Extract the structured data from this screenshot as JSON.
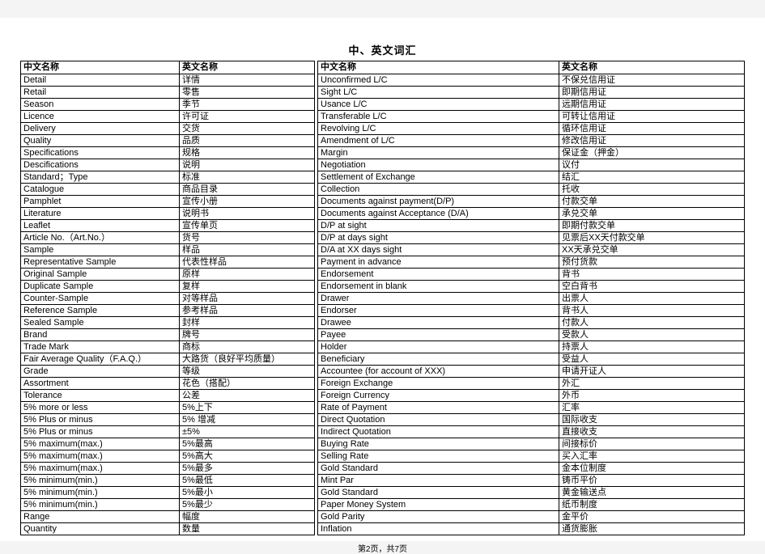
{
  "document": {
    "title": "中、英文词汇",
    "footer": "第2页，共7页"
  },
  "table_left": {
    "headers": [
      "中文名称",
      "英文名称"
    ],
    "rows": [
      [
        "Detail",
        "详情"
      ],
      [
        "Retail",
        "零售"
      ],
      [
        "Season",
        "季节"
      ],
      [
        "Licence",
        "许可证"
      ],
      [
        "Delivery",
        "交货"
      ],
      [
        "Quality",
        "品质"
      ],
      [
        "Specifications",
        "规格"
      ],
      [
        "Descifications",
        "说明"
      ],
      [
        "Standard；Type",
        "标准"
      ],
      [
        "Catalogue",
        "商品目录"
      ],
      [
        "Pamphlet",
        "宣传小册"
      ],
      [
        "Literature",
        "说明书"
      ],
      [
        "Leaflet",
        "宣传单页"
      ],
      [
        "Article No.（Art.No.）",
        "货号"
      ],
      [
        "Sample",
        "样品"
      ],
      [
        "Representative Sample",
        "代表性样品"
      ],
      [
        "Original Sample",
        "原样"
      ],
      [
        "Duplicate Sample",
        "复样"
      ],
      [
        "Counter-Sample",
        "对等样品"
      ],
      [
        "Reference Sample",
        "参考样品"
      ],
      [
        "Sealed Sample",
        "封样"
      ],
      [
        "Brand",
        "牌号"
      ],
      [
        "Trade Mark",
        "商标"
      ],
      [
        "Fair Average Quality（F.A.Q.）",
        "大路货（良好平均质量）"
      ],
      [
        "Grade",
        "等级"
      ],
      [
        "Assortment",
        "花色（搭配）"
      ],
      [
        "Tolerance",
        "公差"
      ],
      [
        "5% more or less",
        "5%上下"
      ],
      [
        "5% Plus or minus",
        "5% 增减"
      ],
      [
        "5% Plus or minus",
        "±5%"
      ],
      [
        "5% maximum(max.)",
        "5%最高"
      ],
      [
        "5% maximum(max.)",
        "5%高大"
      ],
      [
        "5% maximum(max.)",
        "5%最多"
      ],
      [
        "5% minimum(min.)",
        "5%最低"
      ],
      [
        "5% minimum(min.)",
        "5%最小"
      ],
      [
        "5% minimum(min.)",
        "5%最少"
      ],
      [
        "Range",
        "幅度"
      ],
      [
        "Quantity",
        "数量"
      ]
    ]
  },
  "table_right": {
    "headers": [
      "中文名称",
      "英文名称"
    ],
    "rows": [
      [
        "Unconfirmed L/C",
        "不保兑信用证"
      ],
      [
        "Sight L/C",
        "即期信用证"
      ],
      [
        "Usance L/C",
        "远期信用证"
      ],
      [
        "Transferable L/C",
        "可转让信用证"
      ],
      [
        "Revolving L/C",
        "循环信用证"
      ],
      [
        "Amendment of L/C",
        "修改信用证"
      ],
      [
        "Margin",
        "保证金（押金）"
      ],
      [
        "Negotiation",
        "议付"
      ],
      [
        "Settlement of Exchange",
        "结汇"
      ],
      [
        "Collection",
        "托收"
      ],
      [
        "Documents against payment(D/P)",
        "付款交单"
      ],
      [
        "Documents against Acceptance (D/A)",
        "承兑交单"
      ],
      [
        "D/P at sight",
        "即期付款交单"
      ],
      [
        "D/P at  days sight",
        "见票后XX天付款交单"
      ],
      [
        "D/A at XX days sight",
        "XX天承兑交单"
      ],
      [
        "Payment in advance",
        "预付货款"
      ],
      [
        "Endorsement",
        "背书"
      ],
      [
        "Endorsement in blank",
        "空白背书"
      ],
      [
        "Drawer",
        "出票人"
      ],
      [
        "Endorser",
        "背书人"
      ],
      [
        "Drawee",
        "付款人"
      ],
      [
        "Payee",
        "受款人"
      ],
      [
        "Holder",
        "持票人"
      ],
      [
        "Beneficiary",
        "受益人"
      ],
      [
        "Accountee (for account of XXX)",
        "申请开证人"
      ],
      [
        "Foreign Exchange",
        "外汇"
      ],
      [
        "Foreign Currency",
        "外币"
      ],
      [
        "Rate of Payment",
        "汇率"
      ],
      [
        "Direct Quotation",
        "国际收支"
      ],
      [
        "Indirect Quotation",
        "直接收支"
      ],
      [
        "Buying Rate",
        "间接标价"
      ],
      [
        "Selling Rate",
        "买入汇率"
      ],
      [
        "Gold Standard",
        "金本位制度"
      ],
      [
        "Mint Par",
        "铸币平价"
      ],
      [
        "Gold Standard",
        "黄金输送点"
      ],
      [
        "Paper Money System",
        "纸币制度"
      ],
      [
        "Gold Parity",
        "金平价"
      ],
      [
        "Inflation",
        "通货膨胀"
      ]
    ]
  }
}
